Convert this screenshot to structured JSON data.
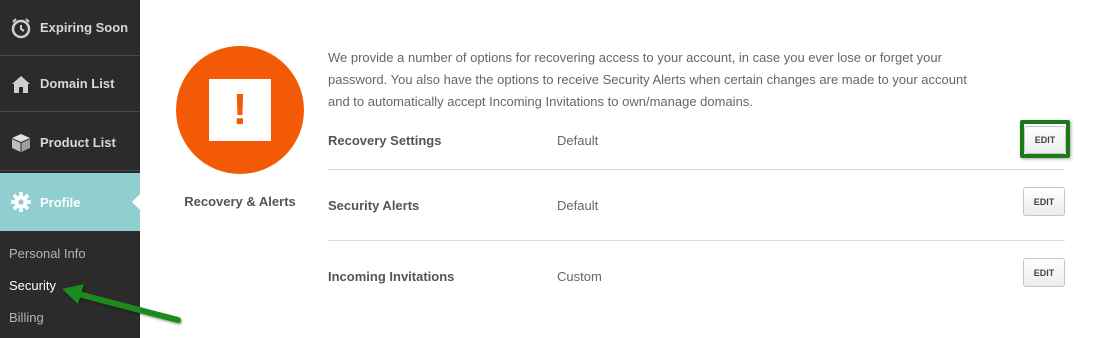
{
  "sidebar": {
    "items": [
      {
        "label": "Expiring Soon",
        "icon": "clock-icon"
      },
      {
        "label": "Domain List",
        "icon": "house-icon"
      },
      {
        "label": "Product List",
        "icon": "box-icon"
      },
      {
        "label": "Profile",
        "icon": "gear-icon",
        "active": true
      }
    ],
    "subitems": [
      {
        "label": "Personal Info"
      },
      {
        "label": "Security",
        "current": true
      },
      {
        "label": "Billing"
      }
    ]
  },
  "section": {
    "badge_symbol": "!",
    "badge_label": "Recovery & Alerts",
    "intro": "We provide a number of options for recovering access to your account, in case you ever lose or forget your password. You also have the options to receive Security Alerts when certain changes are made to your account and to automatically accept Incoming Invitations to own/manage domains."
  },
  "settings": [
    {
      "label": "Recovery Settings",
      "value": "Default",
      "action": "EDIT"
    },
    {
      "label": "Security Alerts",
      "value": "Default",
      "action": "EDIT"
    },
    {
      "label": "Incoming Invitations",
      "value": "Custom",
      "action": "EDIT"
    }
  ],
  "colors": {
    "sidebar_bg": "#2b2b2b",
    "active_nav": "#8fcfcf",
    "badge": "#f25a06",
    "annotation_green": "#1a7a1a"
  }
}
